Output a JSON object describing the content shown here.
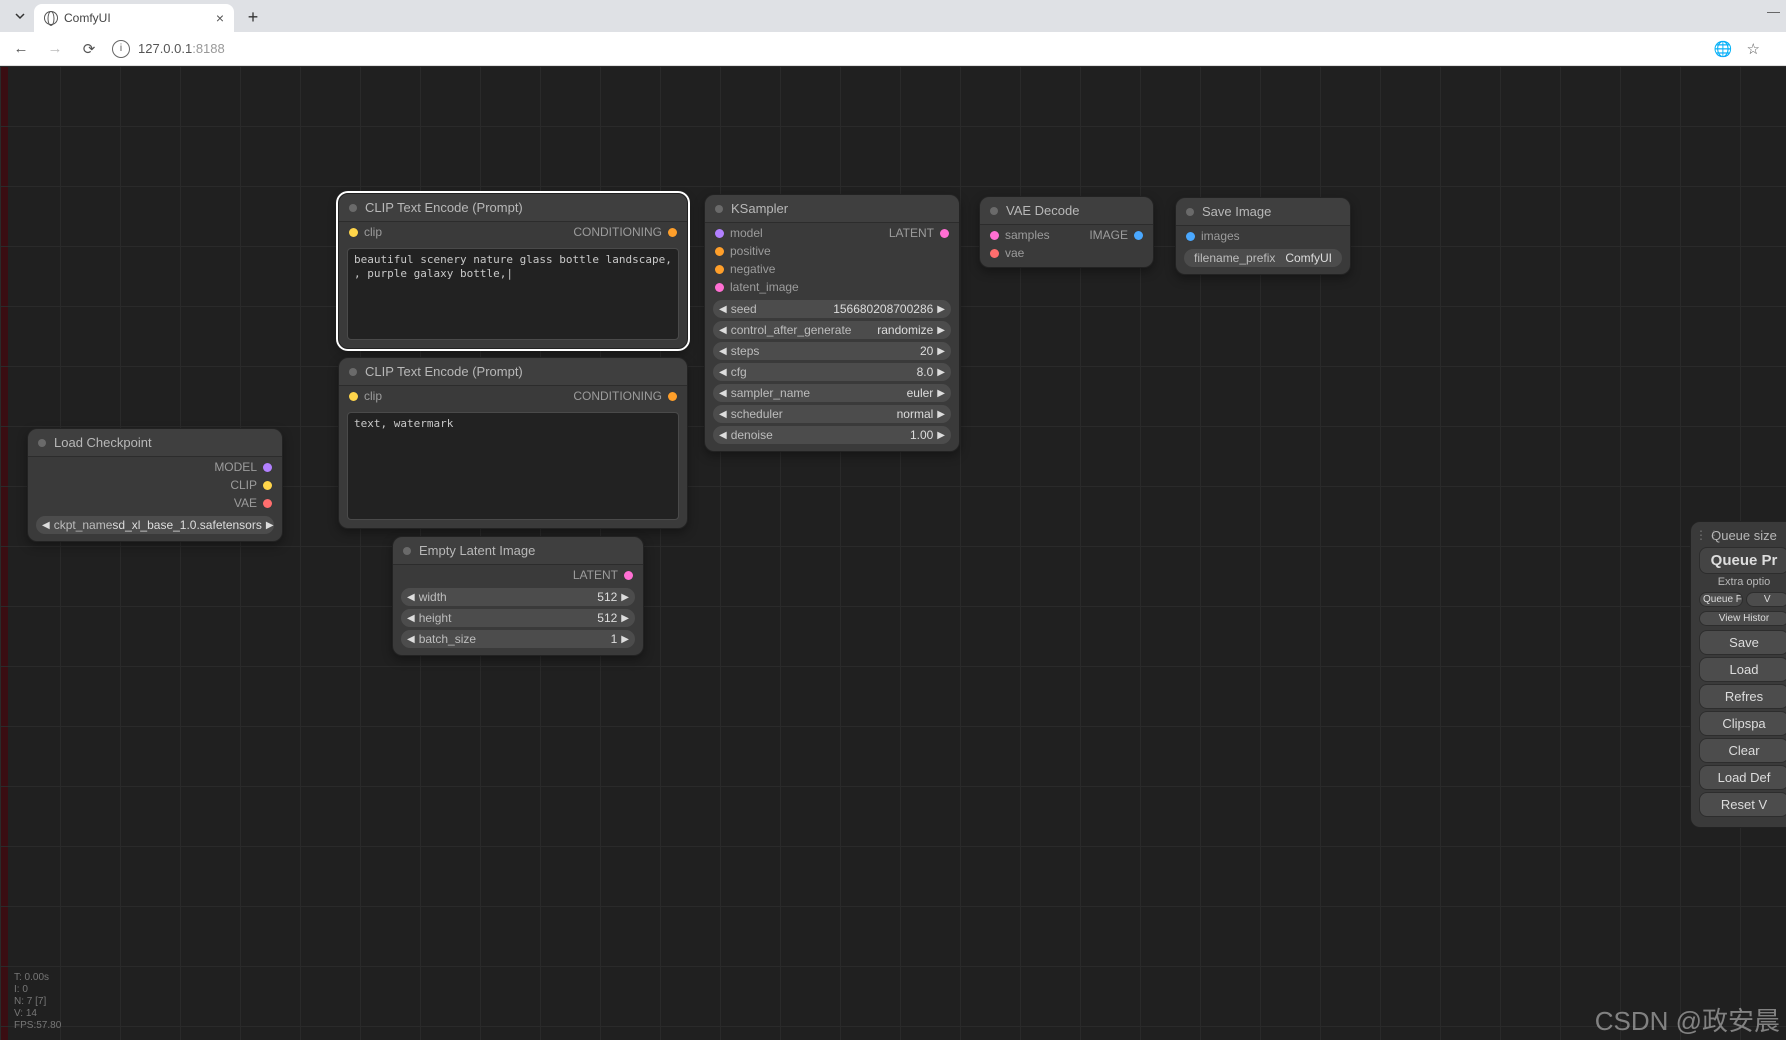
{
  "browser": {
    "tab_title": "ComfyUI",
    "url_host": "127.0.0.1",
    "url_port": ":8188"
  },
  "nodes": {
    "load_ckpt": {
      "title": "Load Checkpoint",
      "outputs": [
        "MODEL",
        "CLIP",
        "VAE"
      ],
      "widget": {
        "name": "ckpt_name",
        "value": "sd_xl_base_1.0.safetensors"
      }
    },
    "clip_pos": {
      "title": "CLIP Text Encode (Prompt)",
      "input": "clip",
      "output": "CONDITIONING",
      "text": "beautiful scenery nature glass bottle landscape, , purple galaxy bottle,|"
    },
    "clip_neg": {
      "title": "CLIP Text Encode (Prompt)",
      "input": "clip",
      "output": "CONDITIONING",
      "text": "text, watermark"
    },
    "empty_latent": {
      "title": "Empty Latent Image",
      "output": "LATENT",
      "widgets": [
        {
          "name": "width",
          "value": "512"
        },
        {
          "name": "height",
          "value": "512"
        },
        {
          "name": "batch_size",
          "value": "1"
        }
      ]
    },
    "ksampler": {
      "title": "KSampler",
      "inputs": [
        "model",
        "positive",
        "negative",
        "latent_image"
      ],
      "output": "LATENT",
      "widgets": [
        {
          "name": "seed",
          "value": "156680208700286"
        },
        {
          "name": "control_after_generate",
          "value": "randomize"
        },
        {
          "name": "steps",
          "value": "20"
        },
        {
          "name": "cfg",
          "value": "8.0"
        },
        {
          "name": "sampler_name",
          "value": "euler"
        },
        {
          "name": "scheduler",
          "value": "normal"
        },
        {
          "name": "denoise",
          "value": "1.00"
        }
      ]
    },
    "vae_decode": {
      "title": "VAE Decode",
      "inputs": [
        "samples",
        "vae"
      ],
      "output": "IMAGE"
    },
    "save_image": {
      "title": "Save Image",
      "input": "images",
      "widget": {
        "name": "filename_prefix",
        "value": "ComfyUI"
      }
    }
  },
  "panel": {
    "queue_size": "Queue size",
    "queue_prompt": "Queue Pr",
    "extra_options": "Extra optio",
    "queue_front": "Queue Front",
    "view_queue": "V",
    "view_history": "View Histor",
    "save": "Save",
    "load": "Load",
    "refresh": "Refres",
    "clipspace": "Clipspa",
    "clear": "Clear",
    "load_default": "Load Def",
    "reset_view": "Reset V"
  },
  "stats": {
    "t": "T: 0.00s",
    "i": "I: 0",
    "n": "N: 7 [7]",
    "v": "V: 14",
    "fps": "FPS:57.80"
  },
  "watermark": "CSDN @政安晨",
  "colors": {
    "model": "#b280ff",
    "clip": "#ffd54a",
    "vae": "#ff6e6e",
    "cond": "#ff9f2a",
    "latent": "#ff6fd3",
    "image": "#4aa8ff"
  }
}
